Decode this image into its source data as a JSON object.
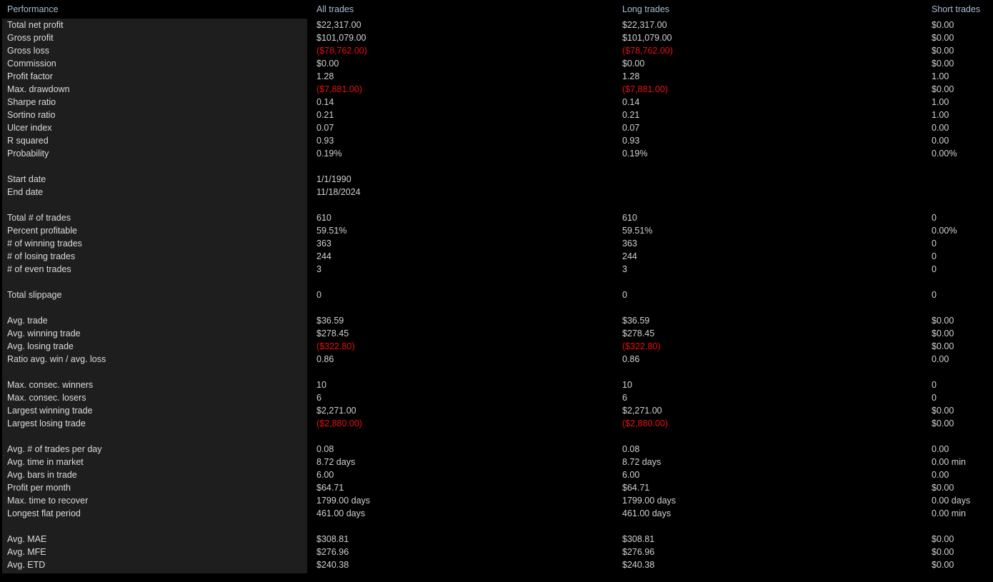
{
  "report": {
    "columns": {
      "label": "Performance",
      "all": "All trades",
      "long": "Long trades",
      "short": "Short trades"
    },
    "colors": {
      "background": "#000000",
      "label_panel": "#1e1e1e",
      "header_text": "#a9bdd6",
      "text": "#d8d8d8",
      "negative": "#e81010"
    },
    "rows": [
      {
        "label": "Total net profit",
        "all": "$22,317.00",
        "long": "$22,317.00",
        "short": "$0.00"
      },
      {
        "label": "Gross profit",
        "all": "$101,079.00",
        "long": "$101,079.00",
        "short": "$0.00"
      },
      {
        "label": "Gross loss",
        "all": "($78,762.00)",
        "long": "($78,762.00)",
        "short": "$0.00",
        "all_neg": true,
        "long_neg": true
      },
      {
        "label": "Commission",
        "all": "$0.00",
        "long": "$0.00",
        "short": "$0.00"
      },
      {
        "label": "Profit factor",
        "all": "1.28",
        "long": "1.28",
        "short": "1.00"
      },
      {
        "label": "Max. drawdown",
        "all": "($7,881.00)",
        "long": "($7,881.00)",
        "short": "$0.00",
        "all_neg": true,
        "long_neg": true
      },
      {
        "label": "Sharpe ratio",
        "all": "0.14",
        "long": "0.14",
        "short": "1.00"
      },
      {
        "label": "Sortino ratio",
        "all": "0.21",
        "long": "0.21",
        "short": "1.00"
      },
      {
        "label": "Ulcer index",
        "all": "0.07",
        "long": "0.07",
        "short": "0.00"
      },
      {
        "label": "R squared",
        "all": "0.93",
        "long": "0.93",
        "short": "0.00"
      },
      {
        "label": "Probability",
        "all": "0.19%",
        "long": "0.19%",
        "short": "0.00%"
      },
      {
        "spacer": true
      },
      {
        "label": "Start date",
        "all": "1/1/1990",
        "long": "",
        "short": ""
      },
      {
        "label": "End date",
        "all": "11/18/2024",
        "long": "",
        "short": ""
      },
      {
        "spacer": true
      },
      {
        "label": "Total # of trades",
        "all": "610",
        "long": "610",
        "short": "0"
      },
      {
        "label": "Percent profitable",
        "all": "59.51%",
        "long": "59.51%",
        "short": "0.00%"
      },
      {
        "label": "# of winning trades",
        "all": "363",
        "long": "363",
        "short": "0"
      },
      {
        "label": "# of losing trades",
        "all": "244",
        "long": "244",
        "short": "0"
      },
      {
        "label": "# of even trades",
        "all": "3",
        "long": "3",
        "short": "0"
      },
      {
        "spacer": true
      },
      {
        "label": "Total slippage",
        "all": "0",
        "long": "0",
        "short": "0"
      },
      {
        "spacer": true
      },
      {
        "label": "Avg. trade",
        "all": "$36.59",
        "long": "$36.59",
        "short": "$0.00"
      },
      {
        "label": "Avg. winning trade",
        "all": "$278.45",
        "long": "$278.45",
        "short": "$0.00"
      },
      {
        "label": "Avg. losing trade",
        "all": "($322.80)",
        "long": "($322.80)",
        "short": "$0.00",
        "all_neg": true,
        "long_neg": true
      },
      {
        "label": "Ratio avg. win / avg. loss",
        "all": "0.86",
        "long": "0.86",
        "short": "0.00"
      },
      {
        "spacer": true
      },
      {
        "label": "Max. consec. winners",
        "all": "10",
        "long": "10",
        "short": "0"
      },
      {
        "label": "Max. consec. losers",
        "all": "6",
        "long": "6",
        "short": "0"
      },
      {
        "label": "Largest winning trade",
        "all": "$2,271.00",
        "long": "$2,271.00",
        "short": "$0.00"
      },
      {
        "label": "Largest losing trade",
        "all": "($2,880.00)",
        "long": "($2,880.00)",
        "short": "$0.00",
        "all_neg": true,
        "long_neg": true
      },
      {
        "spacer": true
      },
      {
        "label": "Avg. # of trades per day",
        "all": "0.08",
        "long": "0.08",
        "short": "0.00"
      },
      {
        "label": "Avg. time in market",
        "all": "8.72 days",
        "long": "8.72 days",
        "short": "0.00 min"
      },
      {
        "label": "Avg. bars in trade",
        "all": "6.00",
        "long": "6.00",
        "short": "0.00"
      },
      {
        "label": "Profit per month",
        "all": "$64.71",
        "long": "$64.71",
        "short": "$0.00"
      },
      {
        "label": "Max. time to recover",
        "all": "1799.00 days",
        "long": "1799.00 days",
        "short": "0.00 days"
      },
      {
        "label": "Longest flat period",
        "all": "461.00 days",
        "long": "461.00 days",
        "short": "0.00 min"
      },
      {
        "spacer": true
      },
      {
        "label": "Avg. MAE",
        "all": "$308.81",
        "long": "$308.81",
        "short": "$0.00"
      },
      {
        "label": "Avg. MFE",
        "all": "$276.96",
        "long": "$276.96",
        "short": "$0.00"
      },
      {
        "label": "Avg. ETD",
        "all": "$240.38",
        "long": "$240.38",
        "short": "$0.00"
      }
    ]
  }
}
